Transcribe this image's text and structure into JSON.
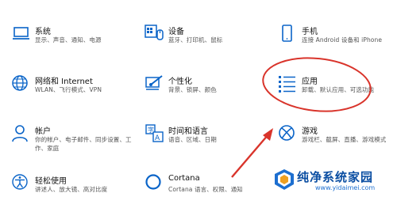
{
  "accent_color": "#0a64c8",
  "annotation_color": "#d9342b",
  "tiles": [
    {
      "icon": "laptop-icon",
      "title": "系统",
      "subtitle": "显示、声音、通知、电源"
    },
    {
      "icon": "devices-icon",
      "title": "设备",
      "subtitle": "蓝牙、打印机、鼠标"
    },
    {
      "icon": "phone-icon",
      "title": "手机",
      "subtitle": "连接 Android 设备和 iPhone"
    },
    {
      "icon": "globe-icon",
      "title": "网络和 Internet",
      "subtitle": "WLAN、飞行模式、VPN"
    },
    {
      "icon": "personalization-icon",
      "title": "个性化",
      "subtitle": "背景、锁屏、颜色"
    },
    {
      "icon": "apps-list-icon",
      "title": "应用",
      "subtitle": "卸载、默认应用、可选功能"
    },
    {
      "icon": "person-icon",
      "title": "帐户",
      "subtitle": "你的帐户、电子邮件、同步设置、工作、家庭"
    },
    {
      "icon": "time-language-icon",
      "title": "时间和语言",
      "subtitle": "语音、区域、日期"
    },
    {
      "icon": "xbox-icon",
      "title": "游戏",
      "subtitle": "游戏栏、截屏、直播、游戏模式"
    },
    {
      "icon": "ease-of-access-icon",
      "title": "轻松使用",
      "subtitle": "讲述人、放大镜、高对比度"
    },
    {
      "icon": "cortana-icon",
      "title": "Cortana",
      "subtitle": "Cortana 语言、权限、通知"
    }
  ],
  "watermark": {
    "name": "纯净系统家园",
    "url": "www.yidaimei.com"
  }
}
